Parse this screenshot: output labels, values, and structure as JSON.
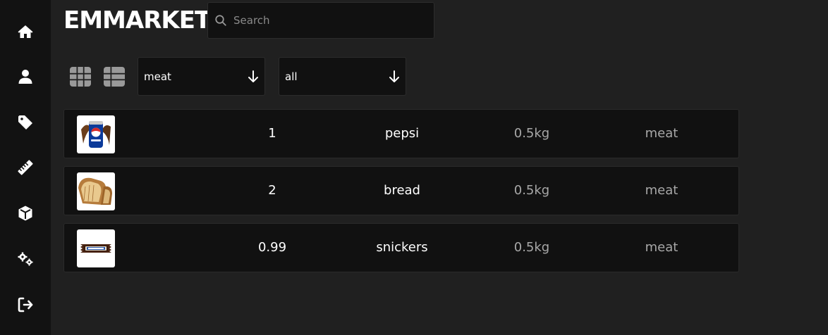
{
  "app": {
    "brand": "EMMARKET"
  },
  "search": {
    "placeholder": "Search",
    "value": ""
  },
  "sidebar": {
    "items": [
      {
        "icon": "home-icon"
      },
      {
        "icon": "user-icon"
      },
      {
        "icon": "tag-icon"
      },
      {
        "icon": "ruler-icon"
      },
      {
        "icon": "box-icon"
      },
      {
        "icon": "gears-icon"
      },
      {
        "icon": "logout-icon"
      }
    ]
  },
  "toolbar": {
    "view_modes": [
      "grid-view-icon",
      "list-view-icon"
    ],
    "category_filter": {
      "selected": "meat"
    },
    "secondary_filter": {
      "selected": "all"
    }
  },
  "products": [
    {
      "image": "pepsi-can",
      "price": "1",
      "name": "pepsi",
      "weight": "0.5kg",
      "category": "meat"
    },
    {
      "image": "bread-loaf",
      "price": "2",
      "name": "bread",
      "weight": "0.5kg",
      "category": "meat"
    },
    {
      "image": "snickers-bar",
      "price": "0.99",
      "name": "snickers",
      "weight": "0.5kg",
      "category": "meat"
    }
  ],
  "colors": {
    "background": "#202020",
    "sidebar": "#121212",
    "panel": "#111111",
    "muted_text": "#a8a8a8"
  }
}
